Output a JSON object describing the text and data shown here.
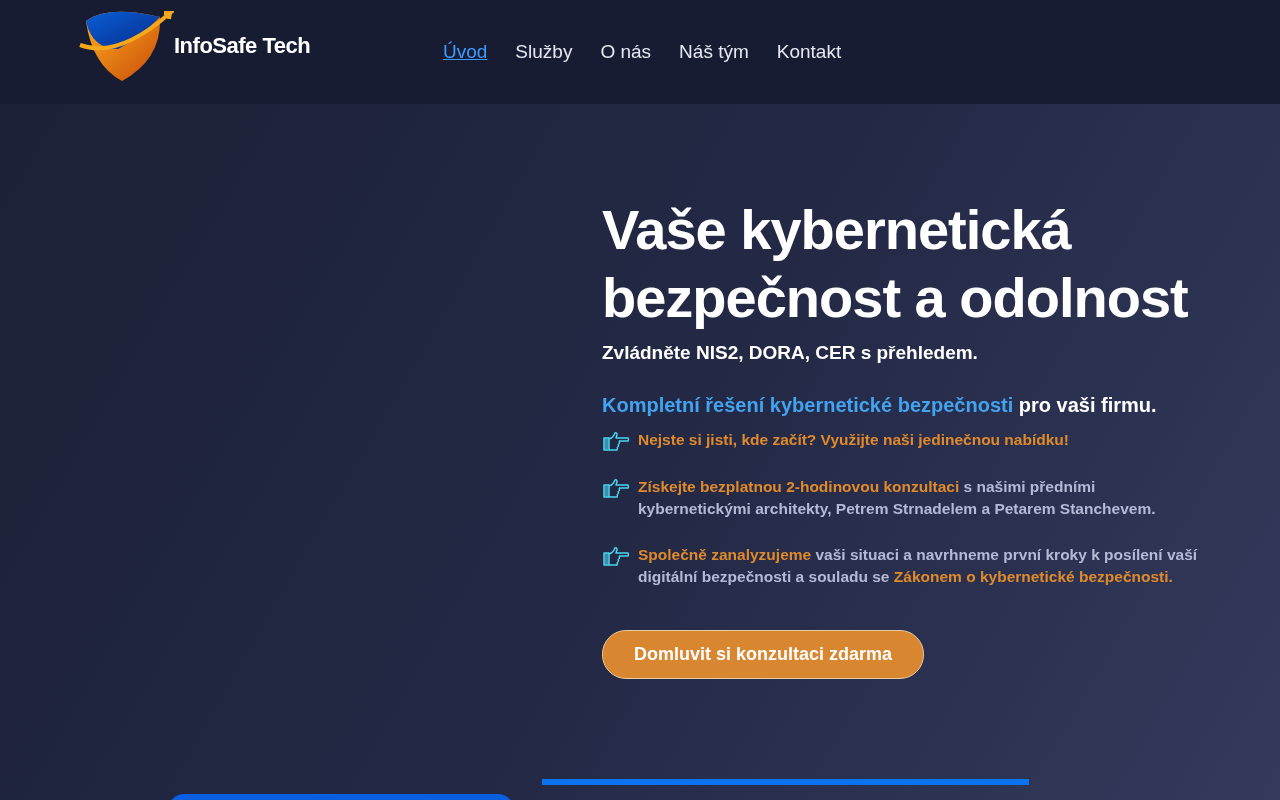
{
  "brand": {
    "name": "InfoSafe Tech"
  },
  "nav": [
    {
      "label": "Úvod",
      "selected": true
    },
    {
      "label": "Služby",
      "selected": false
    },
    {
      "label": "O nás",
      "selected": false
    },
    {
      "label": "Náš tým",
      "selected": false
    },
    {
      "label": "Kontakt",
      "selected": false
    }
  ],
  "hero": {
    "title": "Vaše kybernetická bezpečnost a odolnost",
    "subtitle": "Zvládněte NIS2, DORA, CER s přehledem.",
    "intro": "**Kompletní řešení kybernetické bezpečnosti** pro vaši firmu.",
    "bullets": [
      "**Nejste si jisti, kde začít? Využijte naši jedinečnou nabídku!**",
      "**Získejte bezplatnou 2-hodinovou konzultaci** s našimi předními kybernetickými architekty, Petrem Strnadelem a Petarem Stanchevem.",
      "**Společně zanalyzujeme** vaši situaci a navrhneme první kroky k posílení vaší digitální bezpečnosti a souladu se **Zákonem o kybernetické bezpečnosti.**"
    ],
    "cta": "Domluvit si konzultaci zdarma"
  }
}
